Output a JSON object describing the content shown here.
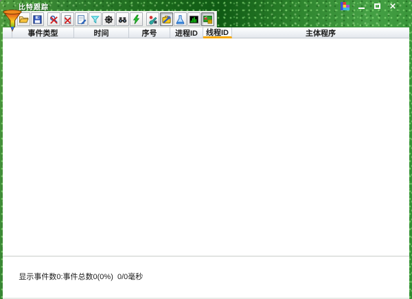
{
  "window": {
    "title": "比特跟踪",
    "controls": [
      {
        "key": "minimize-button",
        "icon": "minimize-icon"
      },
      {
        "key": "maximize-button",
        "icon": "maximize-icon"
      },
      {
        "key": "close-button",
        "icon": "close-icon"
      }
    ]
  },
  "toolbar": {
    "buttons": [
      {
        "icon": "open-icon",
        "pressed": false,
        "group_start": false
      },
      {
        "icon": "save-icon",
        "pressed": false,
        "group_start": false
      },
      {
        "icon": "capture-stop-icon",
        "pressed": false,
        "group_start": true
      },
      {
        "icon": "clear-events-icon",
        "pressed": false,
        "group_start": false
      },
      {
        "icon": "filter-edit-icon",
        "pressed": false,
        "group_start": false
      },
      {
        "icon": "filter-icon",
        "pressed": false,
        "group_start": false
      },
      {
        "icon": "wheel-icon",
        "pressed": false,
        "group_start": false
      },
      {
        "icon": "find-icon",
        "pressed": false,
        "group_start": false
      },
      {
        "icon": "capture-bolt-icon",
        "pressed": false,
        "group_start": false
      },
      {
        "icon": "tools-icon",
        "pressed": false,
        "group_start": true
      },
      {
        "icon": "toolbox-icon",
        "pressed": true,
        "group_start": false
      },
      {
        "icon": "flask-icon",
        "pressed": false,
        "group_start": false
      },
      {
        "icon": "chart-icon",
        "pressed": false,
        "group_start": false
      },
      {
        "icon": "screen-icon",
        "pressed": true,
        "group_start": false
      }
    ]
  },
  "table": {
    "columns": [
      {
        "key": "gutter",
        "label": "",
        "width": 14,
        "selected": false
      },
      {
        "key": "event-type",
        "label": "事件类型",
        "width": 90,
        "selected": false
      },
      {
        "key": "time",
        "label": "时间",
        "width": 80,
        "selected": false
      },
      {
        "key": "seq",
        "label": "序号",
        "width": 60,
        "selected": false
      },
      {
        "key": "process-id",
        "label": "进程ID",
        "width": 48,
        "selected": false
      },
      {
        "key": "thread-id",
        "label": "线程ID",
        "width": 42,
        "selected": true
      },
      {
        "key": "program",
        "label": "主体程序",
        "width": null,
        "selected": false
      }
    ],
    "rows": []
  },
  "statusbar": {
    "text": "显示事件数0:事件总数0(0%)  0/0毫秒"
  },
  "colors": {
    "selected_column_underline": "#f6a800",
    "frame_green_dark": "#0f5a14",
    "frame_green_light": "#4f9b3f",
    "titlebar_text": "#ffffff"
  }
}
